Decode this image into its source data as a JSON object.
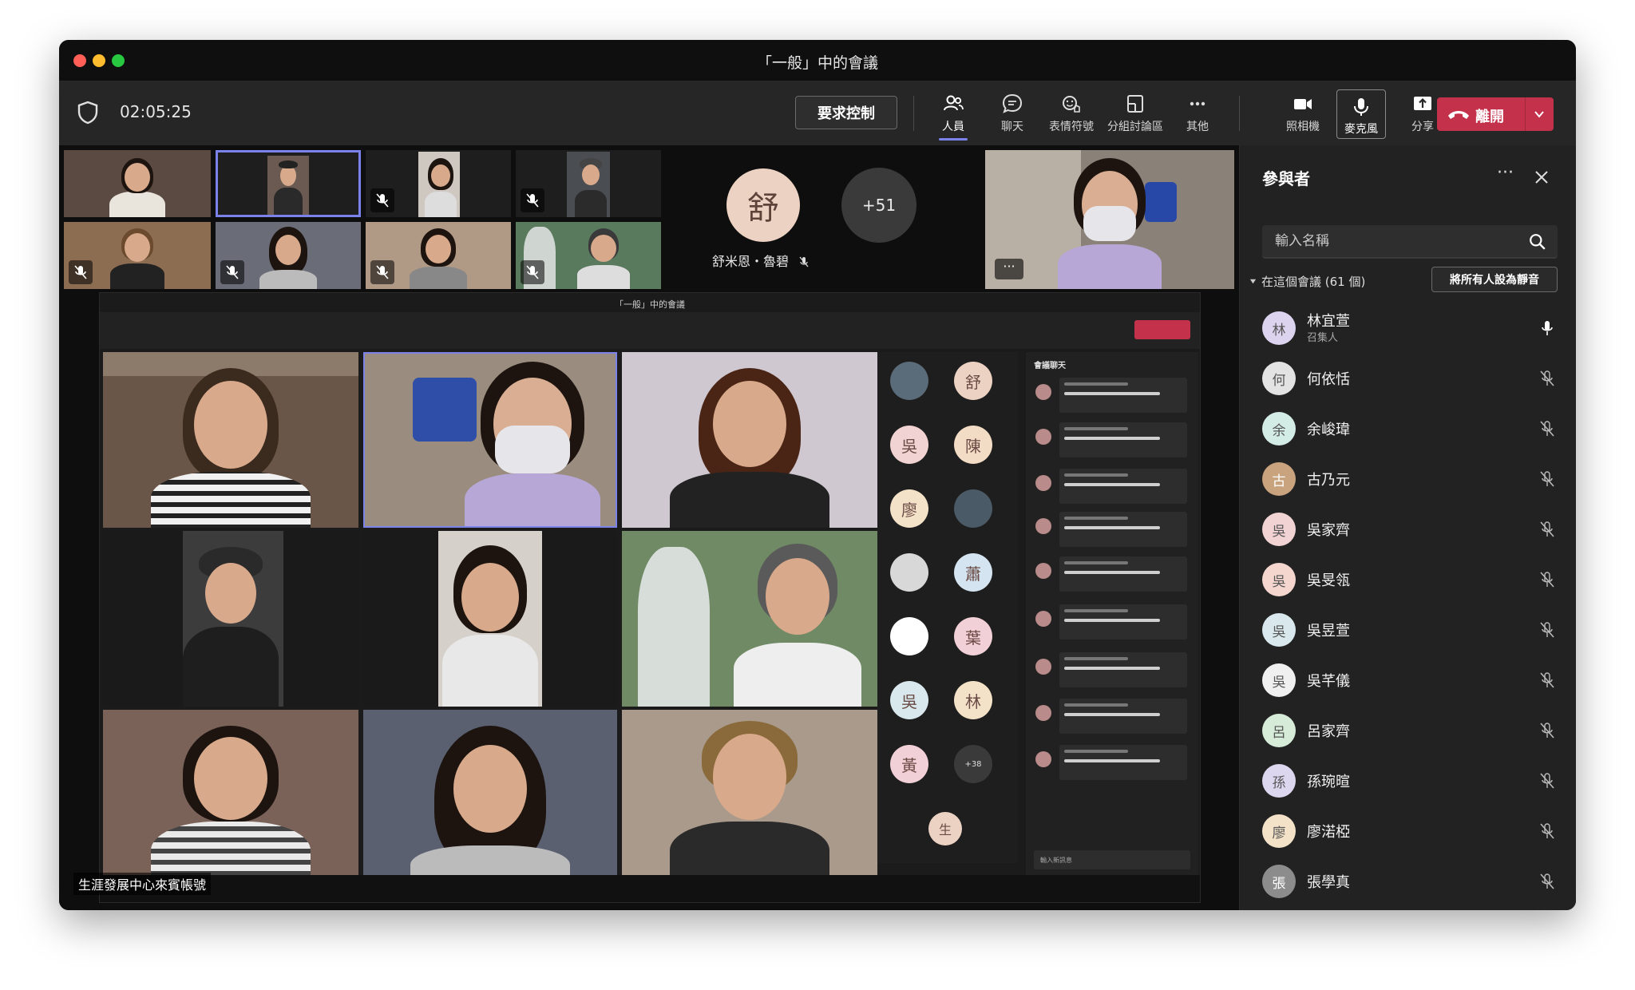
{
  "window": {
    "title": "「一般」中的會議"
  },
  "toolbar": {
    "timer": "02:05:25",
    "request_control": "要求控制",
    "people": "人員",
    "chat": "聊天",
    "reactions": "表情符號",
    "breakout": "分組討論區",
    "more": "其他",
    "camera": "照相機",
    "mic": "麥克風",
    "share": "分享",
    "leave": "離開"
  },
  "stage": {
    "big_avatar": "舒",
    "big_name": "舒米恩・魯碧",
    "overflow_count": "+51",
    "presenter_tooltip": "生涯發展中心來賓帳號"
  },
  "participants_panel": {
    "title": "參與者",
    "search_placeholder": "輸入名稱",
    "section_label": "在這個會議 (61 個)",
    "mute_all": "將所有人設為靜音",
    "people": [
      {
        "initial": "林",
        "name": "林宜萱",
        "role": "召集人",
        "avatar_color": "#dcd3ef",
        "mic": "on"
      },
      {
        "initial": "何",
        "name": "何依恬",
        "role": "",
        "avatar_color": "#e3e3e3",
        "mic": "off"
      },
      {
        "initial": "余",
        "name": "余峻瑋",
        "role": "",
        "avatar_color": "#d4ece6",
        "mic": "off"
      },
      {
        "initial": "古",
        "name": "古乃元",
        "role": "",
        "avatar_color": "#c9a27e",
        "mic": "off"
      },
      {
        "initial": "吳",
        "name": "吳家齊",
        "role": "",
        "avatar_color": "#f1d3d3",
        "mic": "off"
      },
      {
        "initial": "吳",
        "name": "吳旻瓴",
        "role": "",
        "avatar_color": "#f4d6cf",
        "mic": "off"
      },
      {
        "initial": "吳",
        "name": "吳昱萱",
        "role": "",
        "avatar_color": "#d8e8ec",
        "mic": "off"
      },
      {
        "initial": "吳",
        "name": "吳芊儀",
        "role": "",
        "avatar_color": "#f0f0f0",
        "mic": "off"
      },
      {
        "initial": "呂",
        "name": "呂家齊",
        "role": "",
        "avatar_color": "#d6ecd9",
        "mic": "off"
      },
      {
        "initial": "孫",
        "name": "孫琬暄",
        "role": "",
        "avatar_color": "#dcd6ef",
        "mic": "off"
      },
      {
        "initial": "廖",
        "name": "廖渃椏",
        "role": "",
        "avatar_color": "#f3e2c8",
        "mic": "off"
      },
      {
        "initial": "張",
        "name": "張學真",
        "role": "",
        "avatar_color": "#8c8c8c",
        "mic": "off"
      }
    ]
  },
  "inner_meeting": {
    "title": "「一般」中的會議",
    "roster": [
      {
        "initial": "",
        "color": "#5a6b7a"
      },
      {
        "initial": "舒",
        "color": "#ecd2c2"
      },
      {
        "initial": "吳",
        "color": "#f1d3d3"
      },
      {
        "initial": "陳",
        "color": "#f3dcc6"
      },
      {
        "initial": "廖",
        "color": "#f3e2c8"
      },
      {
        "initial": "",
        "color": "#4a5a66"
      },
      {
        "initial": "",
        "color": "#d8d8d8"
      },
      {
        "initial": "蕭",
        "color": "#d4e4f0"
      },
      {
        "initial": "",
        "color": "#ffffff"
      },
      {
        "initial": "葉",
        "color": "#f2d0d8"
      },
      {
        "initial": "吳",
        "color": "#d8e8ec"
      },
      {
        "initial": "林",
        "color": "#f3e2c8"
      },
      {
        "initial": "黃",
        "color": "#f2d0d8"
      },
      {
        "initial": "+38",
        "color": "#3a3a3a"
      }
    ],
    "self_initial": "生",
    "chat_title": "會議聊天",
    "chat_placeholder": "輸入新訊息"
  }
}
